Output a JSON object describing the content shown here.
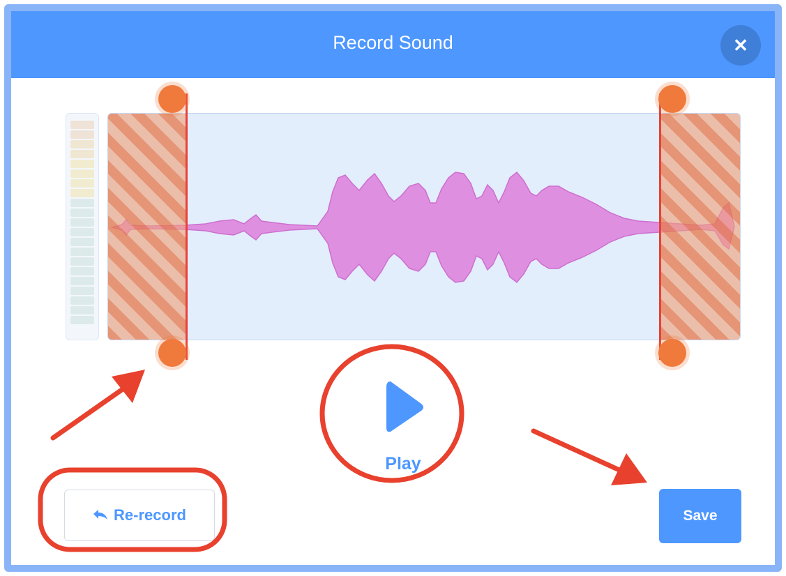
{
  "dialog": {
    "title": "Record Sound",
    "close_icon": "close-icon"
  },
  "controls": {
    "play_label": "Play",
    "rerecord_label": "Re-record",
    "save_label": "Save"
  },
  "icons": {
    "play": "play-icon",
    "undo": "undo-icon"
  },
  "colors": {
    "header": "#4d97ff",
    "accent": "#4d97ff",
    "waveform_fill": "#df8fdf",
    "trim_handle": "#f07a3c",
    "trim_line": "#e8413a",
    "annotation": "#e8412e"
  }
}
